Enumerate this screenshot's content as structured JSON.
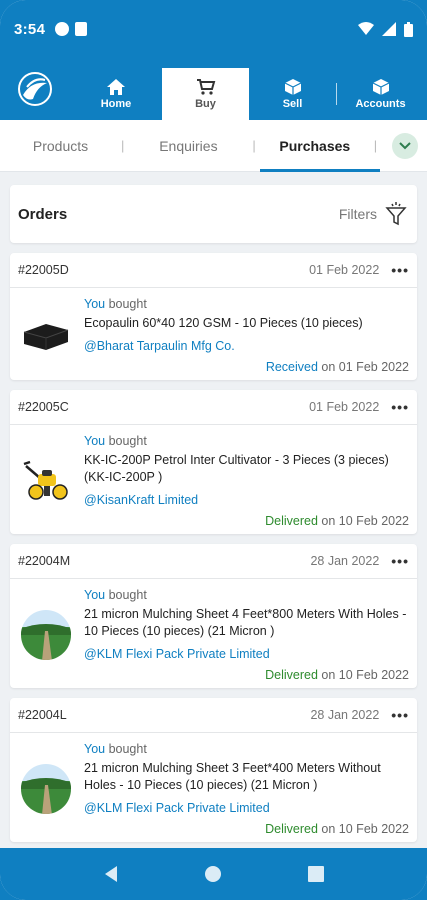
{
  "status_bar": {
    "time": "3:54"
  },
  "nav": {
    "tabs": [
      {
        "label": "Home",
        "icon": "home-icon"
      },
      {
        "label": "Buy",
        "icon": "cart-icon",
        "active": true
      },
      {
        "label": "Sell",
        "icon": "box-icon"
      },
      {
        "label": "Accounts",
        "icon": "box-icon"
      }
    ]
  },
  "subtabs": [
    "Products",
    "Enquiries",
    "Purchases"
  ],
  "orders": {
    "title": "Orders",
    "filters_label": "Filters"
  },
  "cards": [
    {
      "id": "#22005D",
      "date": "01 Feb 2022",
      "you": "You",
      "bought": " bought",
      "product": "Ecopaulin 60*40 120 GSM - 10 Pieces (10 pieces)",
      "seller": "@Bharat Tarpaulin Mfg Co.",
      "status_word": "Received",
      "status_rest": " on 01 Feb 2022"
    },
    {
      "id": "#22005C",
      "date": "01 Feb 2022",
      "you": "You",
      "bought": " bought",
      "product": "KK-IC-200P Petrol Inter Cultivator - 3 Pieces (3 pieces) (KK-IC-200P )",
      "seller": "@KisanKraft Limited",
      "status_word": "Delivered",
      "status_rest": " on 10 Feb 2022"
    },
    {
      "id": "#22004M",
      "date": "28 Jan 2022",
      "you": "You",
      "bought": " bought",
      "product": "21 micron Mulching Sheet 4 Feet*800 Meters With Holes - 10 Pieces (10 pieces) (21 Micron )",
      "seller": "@KLM Flexi Pack Private Limited",
      "status_word": "Delivered",
      "status_rest": " on 10 Feb 2022"
    },
    {
      "id": "#22004L",
      "date": "28 Jan 2022",
      "you": "You",
      "bought": " bought",
      "product": "21 micron Mulching Sheet 3 Feet*400 Meters Without Holes - 10 Pieces (10 pieces) (21 Micron )",
      "seller": "@KLM Flexi Pack Private Limited",
      "status_word": "Delivered",
      "status_rest": " on 10 Feb 2022"
    }
  ],
  "colors": {
    "brand": "#0f7fc1",
    "delivered": "#2e8b2e"
  }
}
